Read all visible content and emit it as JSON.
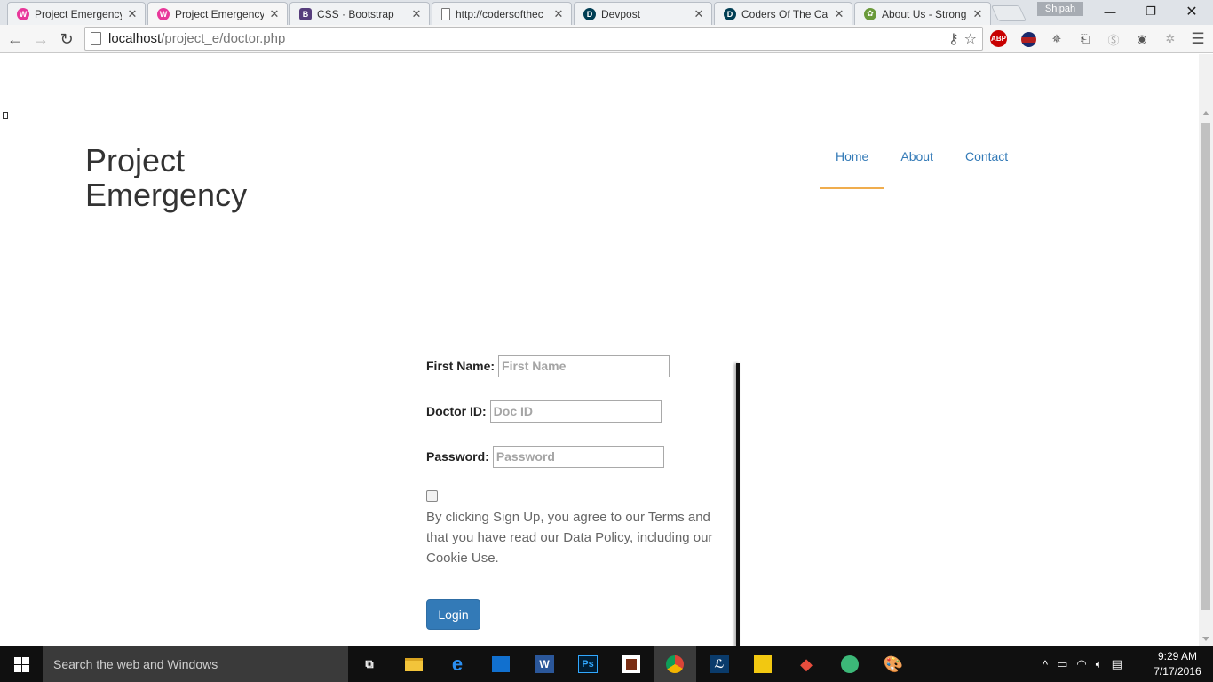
{
  "browser": {
    "tabs": [
      {
        "title": "Project Emergency",
        "favicon": "W",
        "color": "#e8379a",
        "active": false
      },
      {
        "title": "Project Emergency",
        "favicon": "W",
        "color": "#e8379a",
        "active": true
      },
      {
        "title": "CSS · Bootstrap",
        "favicon": "B",
        "color": "#563d7c",
        "active": false
      },
      {
        "title": "http://codersofthec",
        "favicon": "",
        "color": "#ffffff",
        "active": false
      },
      {
        "title": "Devpost",
        "favicon": "D",
        "color": "#003e54",
        "active": false
      },
      {
        "title": "Coders Of The Carib",
        "favicon": "D",
        "color": "#003e54",
        "active": false
      },
      {
        "title": "About Us - Strong",
        "favicon": "✿",
        "color": "#6a9a3a",
        "active": false
      }
    ],
    "profile_name": "Shipah",
    "url_host": "localhost",
    "url_path": "/project_e/doctor.php"
  },
  "site": {
    "brand_line1": "Project",
    "brand_line2": "Emergency",
    "nav": [
      {
        "label": "Home",
        "active": true
      },
      {
        "label": "About",
        "active": false
      },
      {
        "label": "Contact",
        "active": false
      }
    ],
    "accent_color": "#f0ad4e",
    "link_color": "#337ab7"
  },
  "form": {
    "first_name_label": "First Name:",
    "first_name_placeholder": "First Name",
    "doctor_id_label": "Doctor ID:",
    "doctor_id_placeholder": "Doc ID",
    "password_label": "Password:",
    "password_placeholder": "Password",
    "agree_checked": false,
    "terms_text": "By clicking Sign Up, you agree to our Terms and that you have read our Data Policy, including our Cookie Use.",
    "login_label": "Login",
    "button_color": "#337ab7"
  },
  "taskbar": {
    "search_placeholder": "Search the web and Windows",
    "time": "9:29 AM",
    "date": "7/17/2016"
  }
}
